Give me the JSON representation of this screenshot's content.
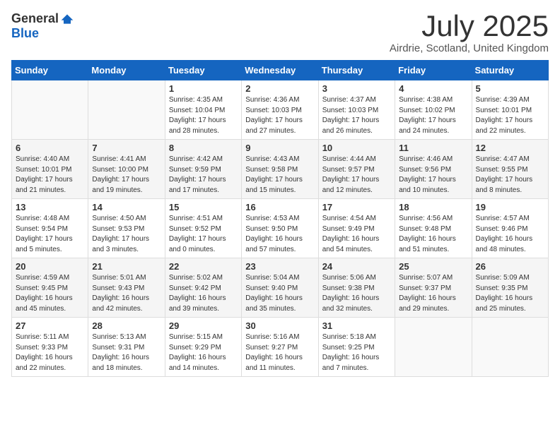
{
  "header": {
    "logo": {
      "general": "General",
      "blue": "Blue"
    },
    "title": "July 2025",
    "subtitle": "Airdrie, Scotland, United Kingdom"
  },
  "days_of_week": [
    "Sunday",
    "Monday",
    "Tuesday",
    "Wednesday",
    "Thursday",
    "Friday",
    "Saturday"
  ],
  "weeks": [
    [
      {
        "day": "",
        "info": ""
      },
      {
        "day": "",
        "info": ""
      },
      {
        "day": "1",
        "info": "Sunrise: 4:35 AM\nSunset: 10:04 PM\nDaylight: 17 hours and 28 minutes."
      },
      {
        "day": "2",
        "info": "Sunrise: 4:36 AM\nSunset: 10:03 PM\nDaylight: 17 hours and 27 minutes."
      },
      {
        "day": "3",
        "info": "Sunrise: 4:37 AM\nSunset: 10:03 PM\nDaylight: 17 hours and 26 minutes."
      },
      {
        "day": "4",
        "info": "Sunrise: 4:38 AM\nSunset: 10:02 PM\nDaylight: 17 hours and 24 minutes."
      },
      {
        "day": "5",
        "info": "Sunrise: 4:39 AM\nSunset: 10:01 PM\nDaylight: 17 hours and 22 minutes."
      }
    ],
    [
      {
        "day": "6",
        "info": "Sunrise: 4:40 AM\nSunset: 10:01 PM\nDaylight: 17 hours and 21 minutes."
      },
      {
        "day": "7",
        "info": "Sunrise: 4:41 AM\nSunset: 10:00 PM\nDaylight: 17 hours and 19 minutes."
      },
      {
        "day": "8",
        "info": "Sunrise: 4:42 AM\nSunset: 9:59 PM\nDaylight: 17 hours and 17 minutes."
      },
      {
        "day": "9",
        "info": "Sunrise: 4:43 AM\nSunset: 9:58 PM\nDaylight: 17 hours and 15 minutes."
      },
      {
        "day": "10",
        "info": "Sunrise: 4:44 AM\nSunset: 9:57 PM\nDaylight: 17 hours and 12 minutes."
      },
      {
        "day": "11",
        "info": "Sunrise: 4:46 AM\nSunset: 9:56 PM\nDaylight: 17 hours and 10 minutes."
      },
      {
        "day": "12",
        "info": "Sunrise: 4:47 AM\nSunset: 9:55 PM\nDaylight: 17 hours and 8 minutes."
      }
    ],
    [
      {
        "day": "13",
        "info": "Sunrise: 4:48 AM\nSunset: 9:54 PM\nDaylight: 17 hours and 5 minutes."
      },
      {
        "day": "14",
        "info": "Sunrise: 4:50 AM\nSunset: 9:53 PM\nDaylight: 17 hours and 3 minutes."
      },
      {
        "day": "15",
        "info": "Sunrise: 4:51 AM\nSunset: 9:52 PM\nDaylight: 17 hours and 0 minutes."
      },
      {
        "day": "16",
        "info": "Sunrise: 4:53 AM\nSunset: 9:50 PM\nDaylight: 16 hours and 57 minutes."
      },
      {
        "day": "17",
        "info": "Sunrise: 4:54 AM\nSunset: 9:49 PM\nDaylight: 16 hours and 54 minutes."
      },
      {
        "day": "18",
        "info": "Sunrise: 4:56 AM\nSunset: 9:48 PM\nDaylight: 16 hours and 51 minutes."
      },
      {
        "day": "19",
        "info": "Sunrise: 4:57 AM\nSunset: 9:46 PM\nDaylight: 16 hours and 48 minutes."
      }
    ],
    [
      {
        "day": "20",
        "info": "Sunrise: 4:59 AM\nSunset: 9:45 PM\nDaylight: 16 hours and 45 minutes."
      },
      {
        "day": "21",
        "info": "Sunrise: 5:01 AM\nSunset: 9:43 PM\nDaylight: 16 hours and 42 minutes."
      },
      {
        "day": "22",
        "info": "Sunrise: 5:02 AM\nSunset: 9:42 PM\nDaylight: 16 hours and 39 minutes."
      },
      {
        "day": "23",
        "info": "Sunrise: 5:04 AM\nSunset: 9:40 PM\nDaylight: 16 hours and 35 minutes."
      },
      {
        "day": "24",
        "info": "Sunrise: 5:06 AM\nSunset: 9:38 PM\nDaylight: 16 hours and 32 minutes."
      },
      {
        "day": "25",
        "info": "Sunrise: 5:07 AM\nSunset: 9:37 PM\nDaylight: 16 hours and 29 minutes."
      },
      {
        "day": "26",
        "info": "Sunrise: 5:09 AM\nSunset: 9:35 PM\nDaylight: 16 hours and 25 minutes."
      }
    ],
    [
      {
        "day": "27",
        "info": "Sunrise: 5:11 AM\nSunset: 9:33 PM\nDaylight: 16 hours and 22 minutes."
      },
      {
        "day": "28",
        "info": "Sunrise: 5:13 AM\nSunset: 9:31 PM\nDaylight: 16 hours and 18 minutes."
      },
      {
        "day": "29",
        "info": "Sunrise: 5:15 AM\nSunset: 9:29 PM\nDaylight: 16 hours and 14 minutes."
      },
      {
        "day": "30",
        "info": "Sunrise: 5:16 AM\nSunset: 9:27 PM\nDaylight: 16 hours and 11 minutes."
      },
      {
        "day": "31",
        "info": "Sunrise: 5:18 AM\nSunset: 9:25 PM\nDaylight: 16 hours and 7 minutes."
      },
      {
        "day": "",
        "info": ""
      },
      {
        "day": "",
        "info": ""
      }
    ]
  ]
}
